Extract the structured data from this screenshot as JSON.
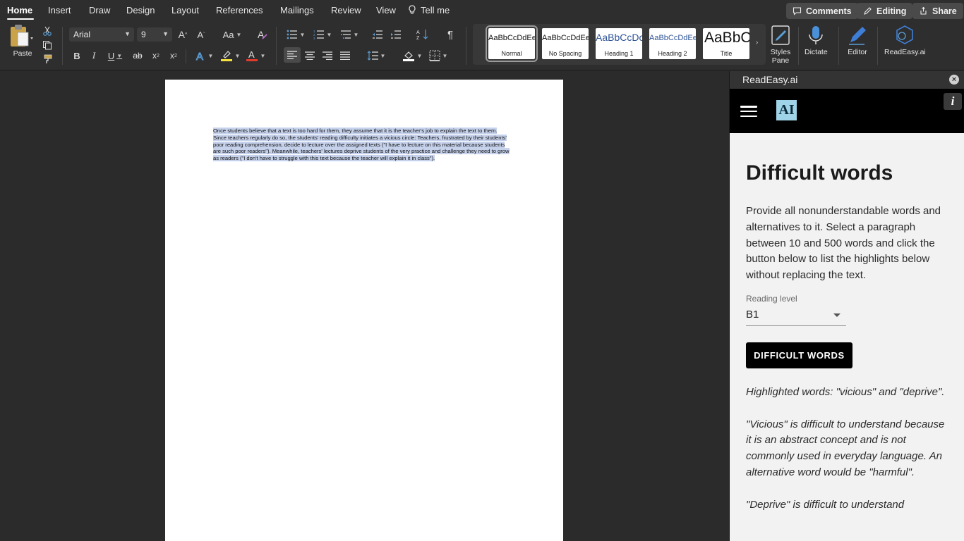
{
  "ribbon_tabs": [
    "Home",
    "Insert",
    "Draw",
    "Design",
    "Layout",
    "References",
    "Mailings",
    "Review",
    "View"
  ],
  "tell_me": "Tell me",
  "top_buttons": {
    "comments": "Comments",
    "editing": "Editing",
    "share": "Share"
  },
  "clipboard": {
    "paste": "Paste"
  },
  "font": {
    "family": "Arial",
    "size": "9",
    "case": "Aa"
  },
  "styles": [
    {
      "sample": "AaBbCcDdEe",
      "name": "Normal"
    },
    {
      "sample": "AaBbCcDdEe",
      "name": "No Spacing"
    },
    {
      "sample": "AaBbCcDc",
      "name": "Heading 1"
    },
    {
      "sample": "AaBbCcDdEe",
      "name": "Heading 2"
    },
    {
      "sample": "AaBbC(",
      "name": "Title"
    }
  ],
  "big_buttons": {
    "styles_pane": "Styles Pane",
    "dictate": "Dictate",
    "editor": "Editor",
    "readeasy": "ReadEasy.ai"
  },
  "colors": {
    "highlight": "#f5e23c",
    "font_color": "#e03b2e",
    "selection": "#c6d2ec",
    "logo_bg": "#9fd4e8"
  },
  "document": {
    "text": "Once students believe that a text is too hard for them, they assume that it is the teacher's job to explain the text to them. Since teachers regularly do so, the students' reading difficulty initiates a vicious circle: Teachers, frustrated by their students' poor reading comprehension, decide to lecture over the assigned texts (\"I have to lecture on this material because students are such poor readers\"). Meanwhile, teachers' lectures deprive students of the very practice and challenge they need to grow as readers (\"I don't have to struggle with this text because the teacher will explain it in class\")."
  },
  "pane": {
    "title": "ReadEasy.ai",
    "logo": "AI",
    "info": "i",
    "heading": "Difficult words",
    "description": "Provide all nonunderstandable words and alternatives to it. Select a paragraph between 10 and 500 words and click the button below to list the highlights below without replacing the text.",
    "reading_level_label": "Reading level",
    "reading_level": "B1",
    "button": "DIFFICULT WORDS",
    "results": [
      "Highlighted words: \"vicious\" and \"deprive\".",
      "\"Vicious\" is difficult to understand because it is an abstract concept and is not commonly used in everyday language. An alternative word would be \"harmful\".",
      "\"Deprive\" is difficult to understand"
    ]
  }
}
